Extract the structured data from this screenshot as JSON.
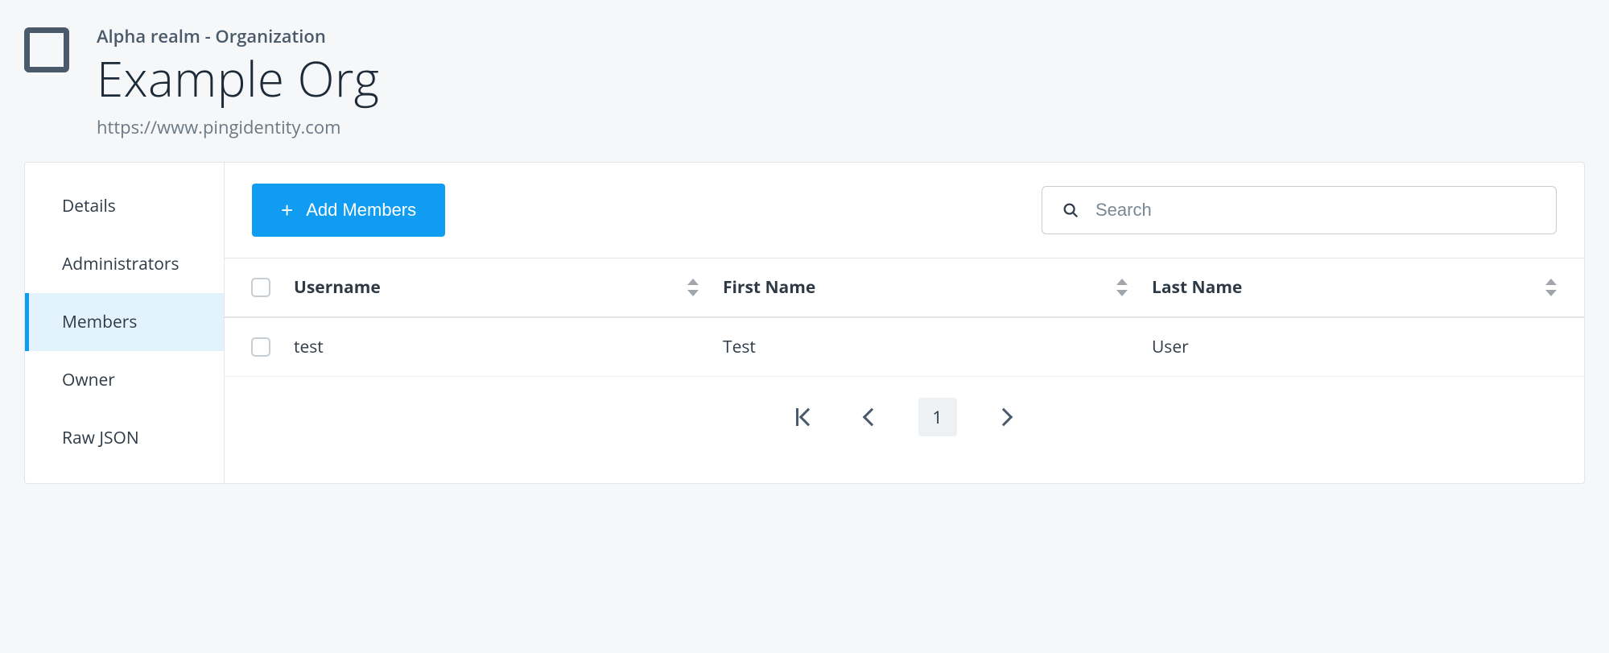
{
  "header": {
    "breadcrumb": "Alpha realm - Organization",
    "title": "Example Org",
    "subtitle": "https://www.pingidentity.com"
  },
  "sidebar": {
    "items": [
      {
        "label": "Details",
        "active": false
      },
      {
        "label": "Administrators",
        "active": false
      },
      {
        "label": "Members",
        "active": true
      },
      {
        "label": "Owner",
        "active": false
      },
      {
        "label": "Raw JSON",
        "active": false
      }
    ]
  },
  "toolbar": {
    "add_label": "Add Members"
  },
  "search": {
    "placeholder": "Search"
  },
  "table": {
    "columns": [
      "Username",
      "First Name",
      "Last Name"
    ],
    "rows": [
      {
        "username": "test",
        "first_name": "Test",
        "last_name": "User"
      }
    ]
  },
  "pagination": {
    "current": "1"
  }
}
